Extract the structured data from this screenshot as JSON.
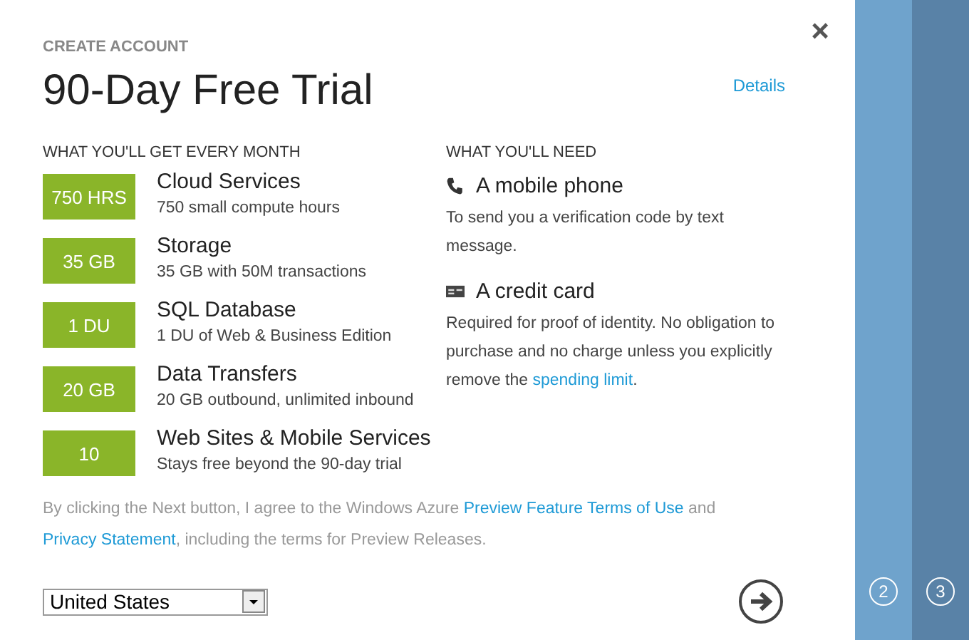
{
  "header": {
    "eyebrow": "CREATE ACCOUNT",
    "title": "90-Day Free Trial",
    "details_link": "Details",
    "close": "×"
  },
  "benefits": {
    "heading": "WHAT YOU'LL GET EVERY MONTH",
    "items": [
      {
        "amount": "750 HRS",
        "name": "Cloud Services",
        "description": "750 small compute hours"
      },
      {
        "amount": "35 GB",
        "name": "Storage",
        "description": "35 GB with 50M transactions"
      },
      {
        "amount": "1 DU",
        "name": "SQL Database",
        "description": "1 DU of Web & Business Edition"
      },
      {
        "amount": "20 GB",
        "name": "Data Transfers",
        "description": "20 GB outbound, unlimited inbound"
      },
      {
        "amount": "10",
        "name": "Web Sites & Mobile Services",
        "description": "Stays free beyond the 90-day trial"
      }
    ]
  },
  "needs": {
    "heading": "WHAT YOU'LL NEED",
    "items": [
      {
        "kind": "phone",
        "title": "A mobile phone",
        "description": [
          {
            "kind": "text",
            "text": "To send you a verification code by text message."
          }
        ]
      },
      {
        "kind": "card",
        "title": "A credit card",
        "description": [
          {
            "kind": "text",
            "text": "Required for proof of identity. No obligation to purchase and no charge unless you explicitly remove the "
          },
          {
            "kind": "link",
            "text": "spending limit"
          },
          {
            "kind": "text",
            "text": "."
          }
        ]
      }
    ]
  },
  "terms": [
    {
      "kind": "text",
      "text": "By clicking the Next button, I agree to the Windows Azure "
    },
    {
      "kind": "link",
      "text": "Preview Feature Terms of Use"
    },
    {
      "kind": "text",
      "text": " and "
    },
    {
      "kind": "link",
      "text": "Privacy Statement"
    },
    {
      "kind": "text",
      "text": ", including the terms for Preview Releases."
    }
  ],
  "country_select": {
    "value": "United States"
  },
  "steps": [
    {
      "label": "2",
      "color": "#6fa3cc"
    },
    {
      "label": "3",
      "color": "#5982a7"
    }
  ]
}
